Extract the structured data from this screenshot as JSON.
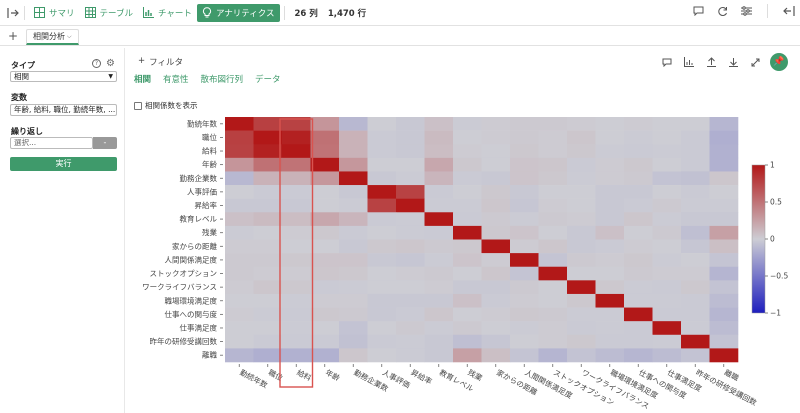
{
  "toolbar": {
    "summary": "サマリ",
    "table": "テーブル",
    "chart": "チャート",
    "analytics": "アナリティクス",
    "columns": "26 列",
    "rows": "1,470 行"
  },
  "tabs": {
    "current": "相関分析"
  },
  "sidebar": {
    "type_label": "タイプ",
    "type_value": "相関",
    "vars_label": "変数",
    "vars_value": "年齢, 給料, 職位, 勤続年数, ...",
    "repeat_label": "繰り返し",
    "repeat_value": "選択...",
    "run_label": "実行"
  },
  "main": {
    "filter_label": "フィルタ",
    "subtabs": [
      "相関",
      "有意性",
      "散布図行列",
      "データ"
    ],
    "show_coef_label": "相関係数を表示"
  },
  "colors": {
    "accent": "#3f9a6b",
    "highlight": "#d9534f"
  },
  "chart_data": {
    "type": "heatmap",
    "title": "",
    "variables": [
      "勤続年数",
      "職位",
      "給料",
      "年齢",
      "勤務企業数",
      "人事評価",
      "昇給率",
      "教育レベル",
      "残業",
      "家からの距離",
      "人間関係満足度",
      "ストックオプション",
      "ワークライフバランス",
      "職場環境満足度",
      "仕事への関与度",
      "仕事満足度",
      "昨年の研修受講回数",
      "離職"
    ],
    "values": [
      [
        1.0,
        0.78,
        0.77,
        0.31,
        -0.12,
        0.0,
        -0.03,
        0.07,
        -0.01,
        0.01,
        0.02,
        0.02,
        0.01,
        0.0,
        0.01,
        0.0,
        0.0,
        -0.13
      ],
      [
        0.78,
        1.0,
        0.95,
        0.51,
        0.15,
        -0.02,
        -0.03,
        0.1,
        0.0,
        0.01,
        0.02,
        0.01,
        0.04,
        0.0,
        -0.01,
        0.0,
        -0.02,
        -0.17
      ],
      [
        0.77,
        0.95,
        1.0,
        0.5,
        0.15,
        -0.02,
        -0.03,
        0.09,
        0.01,
        0.0,
        0.03,
        0.01,
        0.03,
        -0.01,
        -0.02,
        -0.01,
        -0.02,
        -0.16
      ],
      [
        0.31,
        0.51,
        0.5,
        1.0,
        0.3,
        0.0,
        0.0,
        0.21,
        0.03,
        0.0,
        0.05,
        0.04,
        -0.02,
        0.01,
        0.03,
        0.0,
        -0.02,
        -0.16
      ],
      [
        -0.12,
        0.15,
        0.15,
        0.3,
        1.0,
        -0.03,
        -0.01,
        0.13,
        -0.02,
        -0.03,
        0.05,
        0.03,
        -0.01,
        0.01,
        0.02,
        -0.06,
        -0.07,
        0.04
      ],
      [
        0.0,
        -0.02,
        -0.02,
        0.0,
        -0.03,
        1.0,
        0.77,
        -0.02,
        0.0,
        0.03,
        -0.03,
        0.0,
        0.0,
        -0.03,
        -0.03,
        0.0,
        -0.02,
        0.0
      ],
      [
        -0.03,
        -0.03,
        -0.03,
        0.0,
        -0.01,
        0.77,
        1.0,
        -0.01,
        -0.01,
        0.04,
        -0.04,
        0.01,
        0.0,
        -0.03,
        -0.02,
        0.02,
        -0.01,
        -0.01
      ],
      [
        0.07,
        0.1,
        0.09,
        0.21,
        0.13,
        -0.02,
        -0.01,
        1.0,
        -0.02,
        0.02,
        -0.01,
        0.02,
        0.01,
        -0.03,
        0.04,
        -0.01,
        -0.03,
        -0.03
      ],
      [
        -0.01,
        0.0,
        0.01,
        0.03,
        -0.02,
        0.0,
        -0.01,
        -0.02,
        1.0,
        0.03,
        0.05,
        -0.0,
        -0.03,
        0.07,
        -0.0,
        0.02,
        -0.08,
        0.25
      ],
      [
        0.01,
        0.01,
        0.0,
        0.0,
        -0.03,
        0.03,
        0.04,
        0.02,
        0.03,
        1.0,
        0.01,
        0.04,
        -0.03,
        -0.02,
        0.01,
        0.0,
        -0.04,
        0.08
      ],
      [
        0.02,
        0.02,
        0.03,
        0.05,
        0.05,
        -0.03,
        -0.04,
        -0.01,
        0.05,
        0.01,
        1.0,
        -0.05,
        0.02,
        0.01,
        0.03,
        -0.01,
        0.0,
        -0.05
      ],
      [
        0.02,
        0.01,
        0.01,
        0.04,
        0.03,
        0.0,
        0.01,
        0.02,
        -0.0,
        0.04,
        -0.05,
        1.0,
        0.0,
        0.0,
        0.02,
        0.01,
        0.01,
        -0.14
      ],
      [
        0.01,
        0.04,
        0.03,
        -0.02,
        -0.01,
        0.0,
        0.0,
        0.01,
        -0.03,
        -0.03,
        0.02,
        0.0,
        1.0,
        0.03,
        -0.01,
        -0.02,
        0.03,
        -0.06
      ],
      [
        0.0,
        0.0,
        -0.01,
        0.01,
        0.01,
        -0.03,
        -0.03,
        -0.03,
        0.07,
        -0.02,
        0.01,
        0.0,
        0.03,
        1.0,
        -0.01,
        -0.01,
        -0.02,
        -0.1
      ],
      [
        0.01,
        -0.01,
        -0.02,
        0.03,
        0.02,
        -0.03,
        -0.02,
        0.04,
        -0.0,
        0.01,
        0.03,
        0.02,
        -0.01,
        -0.01,
        1.0,
        -0.02,
        -0.02,
        -0.13
      ],
      [
        0.0,
        0.0,
        -0.01,
        0.0,
        -0.06,
        0.0,
        0.02,
        -0.01,
        0.02,
        0.0,
        -0.01,
        0.01,
        -0.02,
        -0.01,
        -0.02,
        1.0,
        -0.01,
        -0.1
      ],
      [
        0.0,
        -0.02,
        -0.02,
        -0.02,
        -0.07,
        -0.02,
        -0.01,
        -0.03,
        -0.08,
        -0.04,
        0.0,
        0.01,
        0.03,
        -0.02,
        -0.02,
        -0.01,
        1.0,
        -0.06
      ],
      [
        -0.13,
        -0.17,
        -0.16,
        -0.16,
        0.04,
        0.0,
        -0.01,
        -0.03,
        0.25,
        0.08,
        -0.05,
        -0.14,
        -0.06,
        -0.1,
        -0.13,
        -0.1,
        -0.06,
        1.0
      ]
    ],
    "colorbar_ticks": [
      1,
      0.5,
      0,
      -0.5,
      -1
    ],
    "zlim": [
      -1,
      1
    ],
    "highlight_column": "給料"
  }
}
